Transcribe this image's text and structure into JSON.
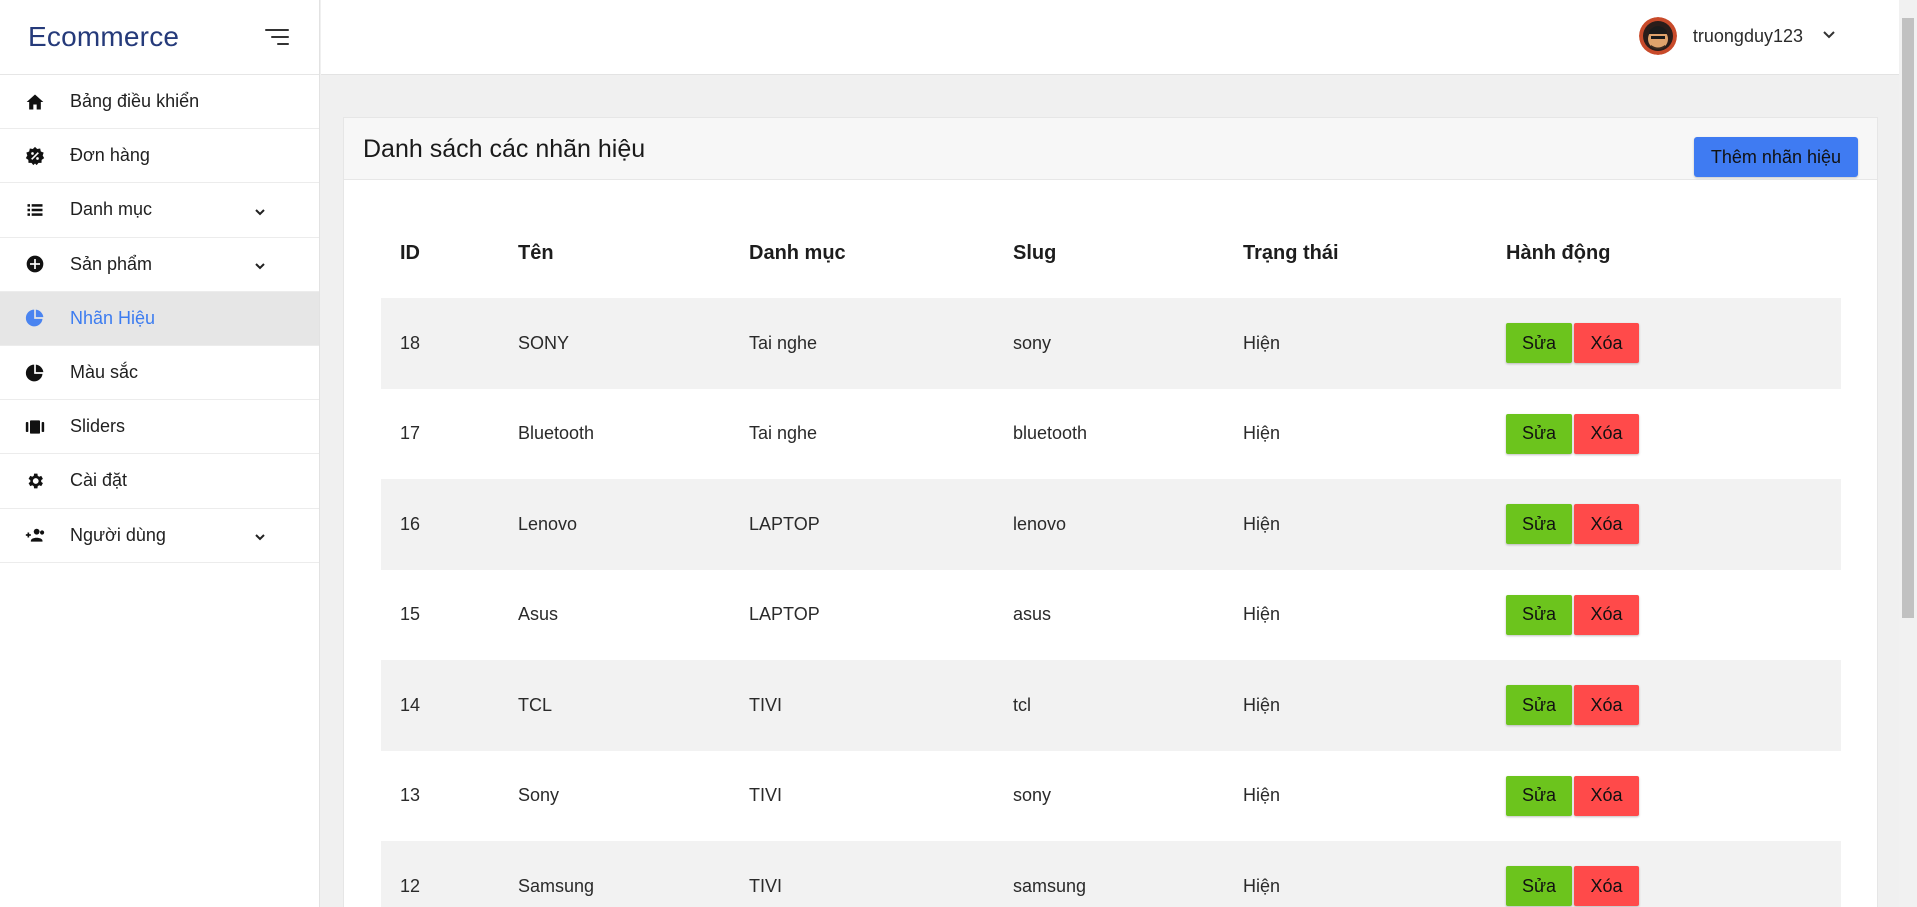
{
  "brand": {
    "title": "Ecommerce"
  },
  "sidebar": {
    "items": [
      {
        "label": "Bảng điều khiển",
        "icon": "home-icon",
        "has_submenu": false,
        "active": false
      },
      {
        "label": "Đơn hàng",
        "icon": "badge-percent-icon",
        "has_submenu": false,
        "active": false
      },
      {
        "label": "Danh mục",
        "icon": "list-icon",
        "has_submenu": true,
        "active": false
      },
      {
        "label": "Sản phẩm",
        "icon": "plus-circle-icon",
        "has_submenu": true,
        "active": false
      },
      {
        "label": "Nhãn Hiệu",
        "icon": "pie-chart-icon",
        "has_submenu": false,
        "active": true
      },
      {
        "label": "Màu sắc",
        "icon": "pie-chart-icon",
        "has_submenu": false,
        "active": false
      },
      {
        "label": "Sliders",
        "icon": "slider-icon",
        "has_submenu": false,
        "active": false
      },
      {
        "label": "Cài đặt",
        "icon": "gear-icon",
        "has_submenu": false,
        "active": false
      },
      {
        "label": "Người dùng",
        "icon": "user-plus-icon",
        "has_submenu": true,
        "active": false
      }
    ]
  },
  "header": {
    "username": "truongduy123"
  },
  "main": {
    "title": "Danh sách các nhãn hiệu",
    "add_button": "Thêm nhãn hiệu",
    "columns": [
      "ID",
      "Tên",
      "Danh mục",
      "Slug",
      "Trạng thái",
      "Hành động"
    ],
    "rows": [
      {
        "id": "18",
        "name": "SONY",
        "category": "Tai nghe",
        "slug": "sony",
        "status": "Hiện"
      },
      {
        "id": "17",
        "name": "Bluetooth",
        "category": "Tai nghe",
        "slug": "bluetooth",
        "status": "Hiện"
      },
      {
        "id": "16",
        "name": "Lenovo",
        "category": "LAPTOP",
        "slug": "lenovo",
        "status": "Hiện"
      },
      {
        "id": "15",
        "name": "Asus",
        "category": "LAPTOP",
        "slug": "asus",
        "status": "Hiện"
      },
      {
        "id": "14",
        "name": "TCL",
        "category": "TIVI",
        "slug": "tcl",
        "status": "Hiện"
      },
      {
        "id": "13",
        "name": "Sony",
        "category": "TIVI",
        "slug": "sony",
        "status": "Hiện"
      },
      {
        "id": "12",
        "name": "Samsung",
        "category": "TIVI",
        "slug": "samsung",
        "status": "Hiện"
      }
    ],
    "edit_label": "Sửa",
    "delete_label": "Xóa"
  },
  "colors": {
    "brand_text": "#253a7a",
    "active_nav": "#3c7cf0",
    "add_button": "#3f7bf2",
    "edit_button": "#6cc41d",
    "delete_button": "#ff4a4a"
  }
}
